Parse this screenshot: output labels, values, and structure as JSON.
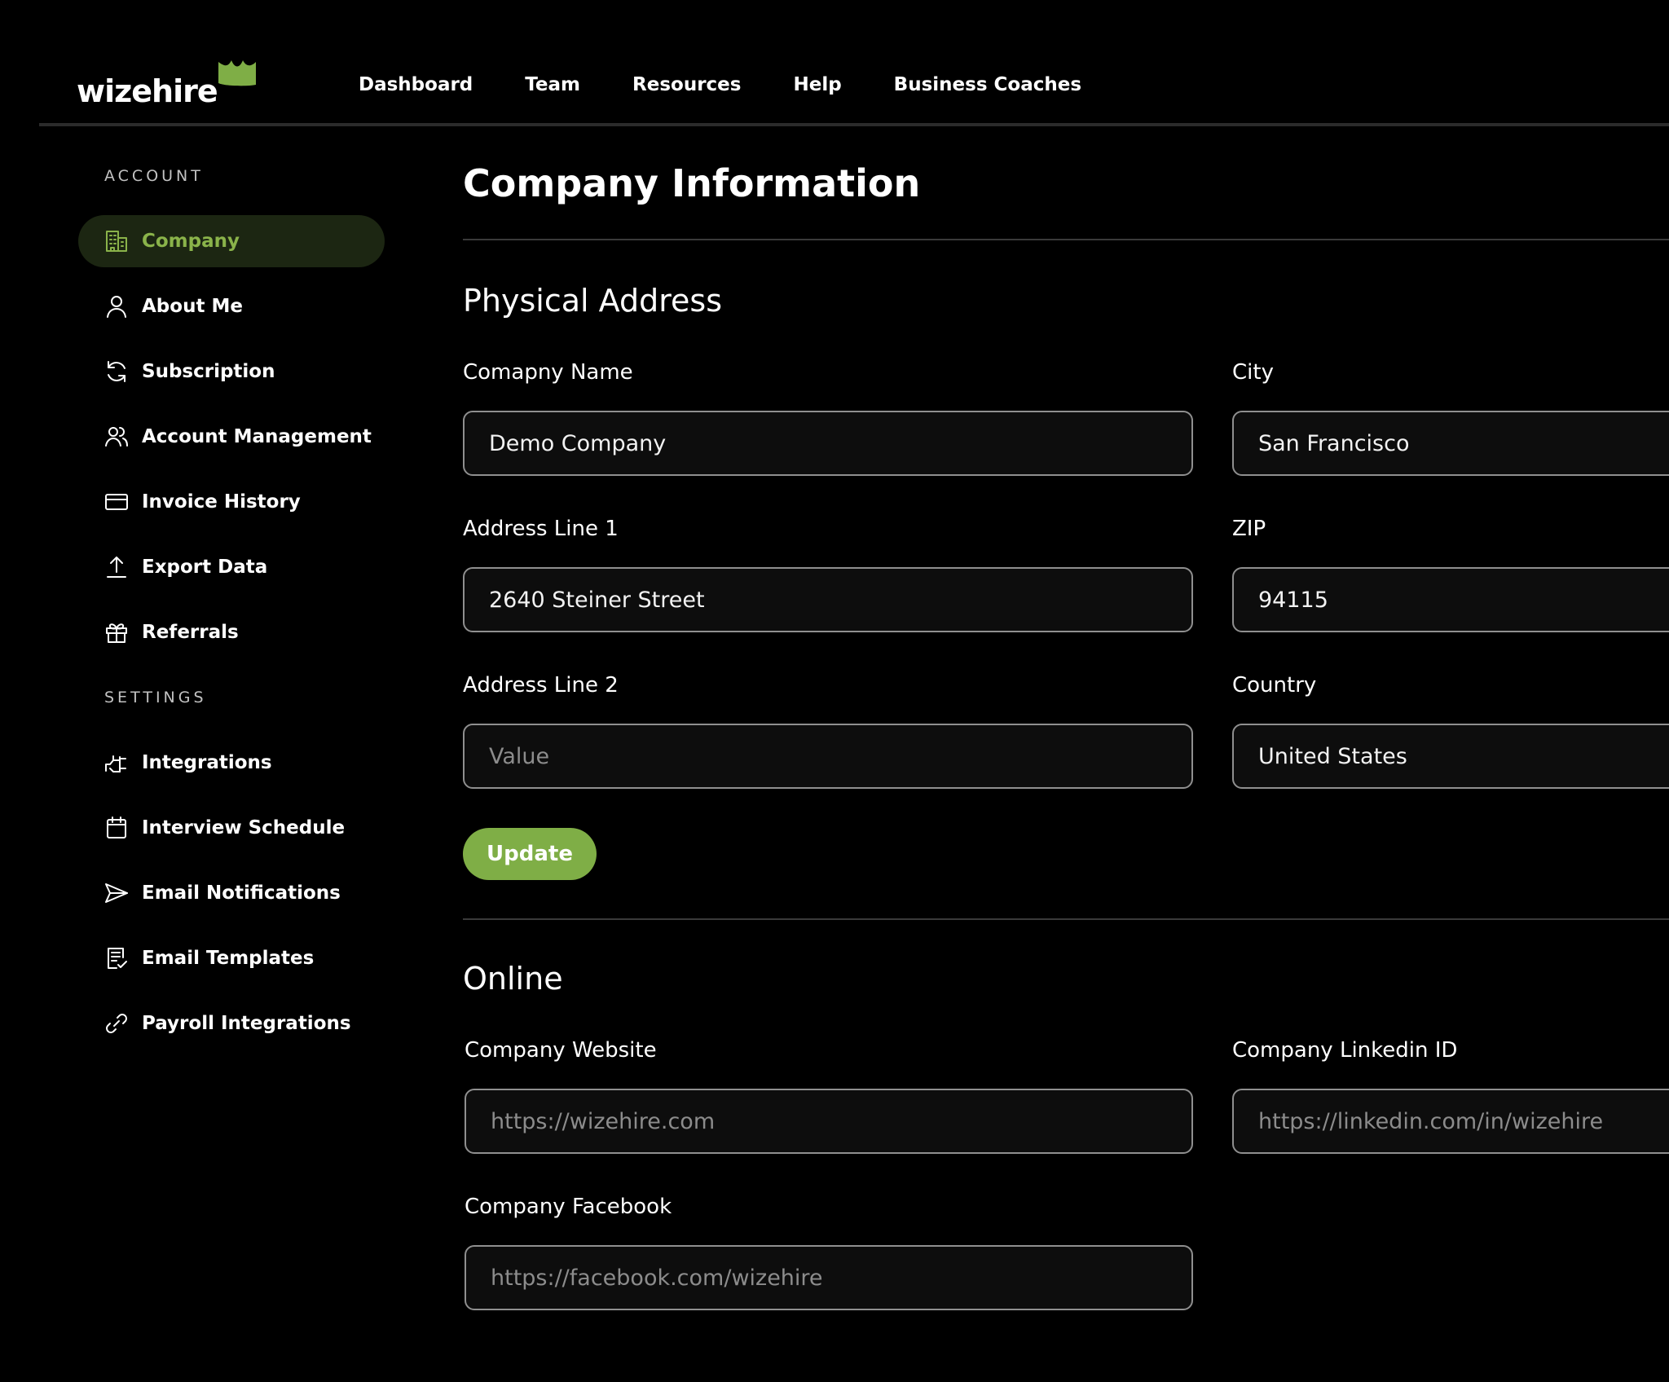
{
  "brand": {
    "logo_text": "wizehire",
    "accent_color": "#7fae46"
  },
  "nav": {
    "items": [
      "Dashboard",
      "Team",
      "Resources",
      "Help",
      "Business Coaches"
    ]
  },
  "sidebar": {
    "account_label": "ACCOUNT",
    "settings_label": "SETTINGS",
    "account_items": [
      {
        "label": "Company",
        "icon": "building-icon",
        "active": true
      },
      {
        "label": "About Me",
        "icon": "user-icon"
      },
      {
        "label": "Subscription",
        "icon": "refresh-icon"
      },
      {
        "label": "Account Management",
        "icon": "users-icon"
      },
      {
        "label": "Invoice History",
        "icon": "credit-card-icon"
      },
      {
        "label": "Export Data",
        "icon": "upload-icon"
      },
      {
        "label": "Referrals",
        "icon": "gift-icon"
      }
    ],
    "settings_items": [
      {
        "label": "Integrations",
        "icon": "plug-icon"
      },
      {
        "label": "Interview Schedule",
        "icon": "calendar-icon"
      },
      {
        "label": "Email Notifications",
        "icon": "send-icon"
      },
      {
        "label": "Email Templates",
        "icon": "document-check-icon"
      },
      {
        "label": "Payroll Integrations",
        "icon": "link-icon"
      }
    ]
  },
  "main": {
    "title": "Company Information",
    "physical_address": {
      "heading": "Physical Address",
      "company_name": {
        "label": "Comapny Name",
        "value": "Demo Company"
      },
      "city": {
        "label": "City",
        "value": "San Francisco"
      },
      "address_line_1": {
        "label": "Address Line 1",
        "value": "2640 Steiner Street"
      },
      "zip": {
        "label": "ZIP",
        "value": "94115"
      },
      "address_line_2": {
        "label": "Address Line 2",
        "value": "",
        "placeholder": "Value"
      },
      "country": {
        "label": "Country",
        "value": "United States"
      },
      "update_label": "Update"
    },
    "online": {
      "heading": "Online",
      "website": {
        "label": "Company Website",
        "placeholder": "https://wizehire.com"
      },
      "linkedin": {
        "label": "Company Linkedin ID",
        "placeholder": "https://linkedin.com/in/wizehire"
      },
      "facebook": {
        "label": "Company Facebook",
        "placeholder": "https://facebook.com/wizehire"
      }
    }
  }
}
